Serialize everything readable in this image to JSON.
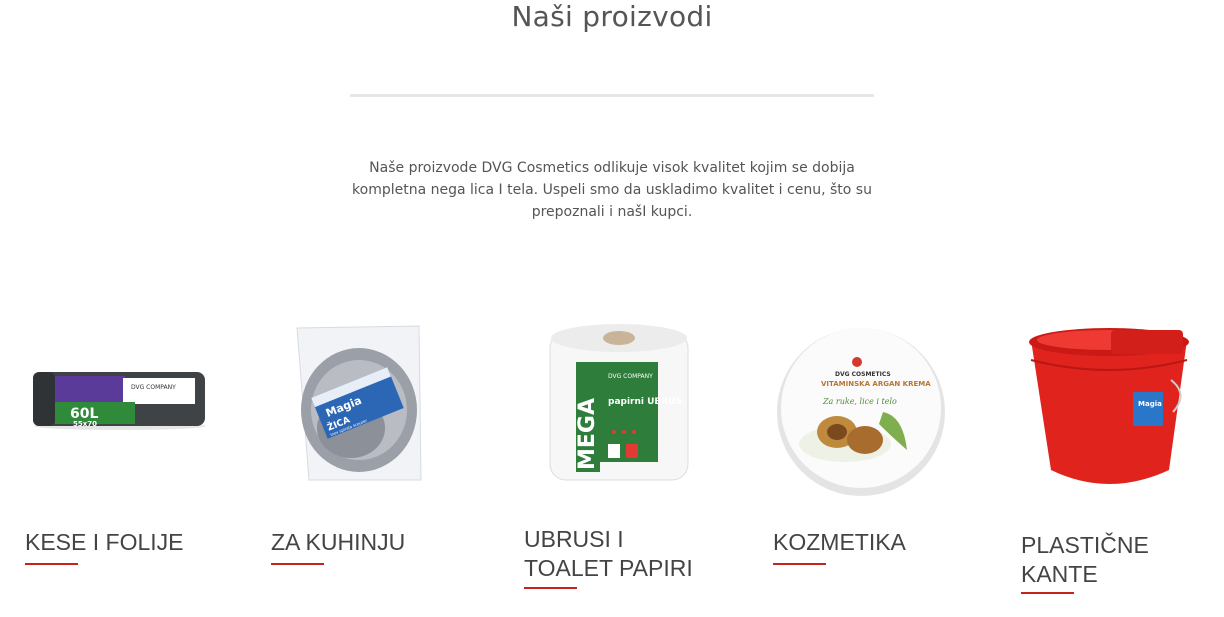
{
  "section": {
    "title": "Naši proizvodi",
    "intro": "Naše proizvode DVG Cosmetics odlikuje visok kvalitet kojim se dobija kompletna nega lica I tela. Uspeli smo da uskladimo kvalitet i cenu, što su prepoznali i našI kupci."
  },
  "colors": {
    "accent": "#c8221f"
  },
  "products": [
    {
      "label": "KESE I FOLIJE",
      "image": "garbage-bags-roll",
      "pack_text": "60L",
      "pack_size": "55x70",
      "pack_brand": "DVG COMPANY"
    },
    {
      "label": "ZA KUHINJU",
      "image": "steel-scourer-pack",
      "pack_brand": "Magia",
      "pack_text": "ŽICA",
      "pack_sub": "inox spirala scourer"
    },
    {
      "label": "UBRUSI I TOALET PAPIRI",
      "image": "mega-paper-towel",
      "pack_brand": "DVG COMPANY",
      "pack_big": "MEGA",
      "pack_text": "papirni UBRUS"
    },
    {
      "label": "KOZMETIKA",
      "image": "argan-cream-jar",
      "pack_brand": "DVG COSMETICS",
      "pack_text": "VITAMINSKA ARGAN KREMA",
      "pack_sub": "Za ruke, lice i telo"
    },
    {
      "label": "PLASTIČNE KANTE",
      "image": "red-mop-bucket",
      "pack_brand": "Magia"
    }
  ]
}
